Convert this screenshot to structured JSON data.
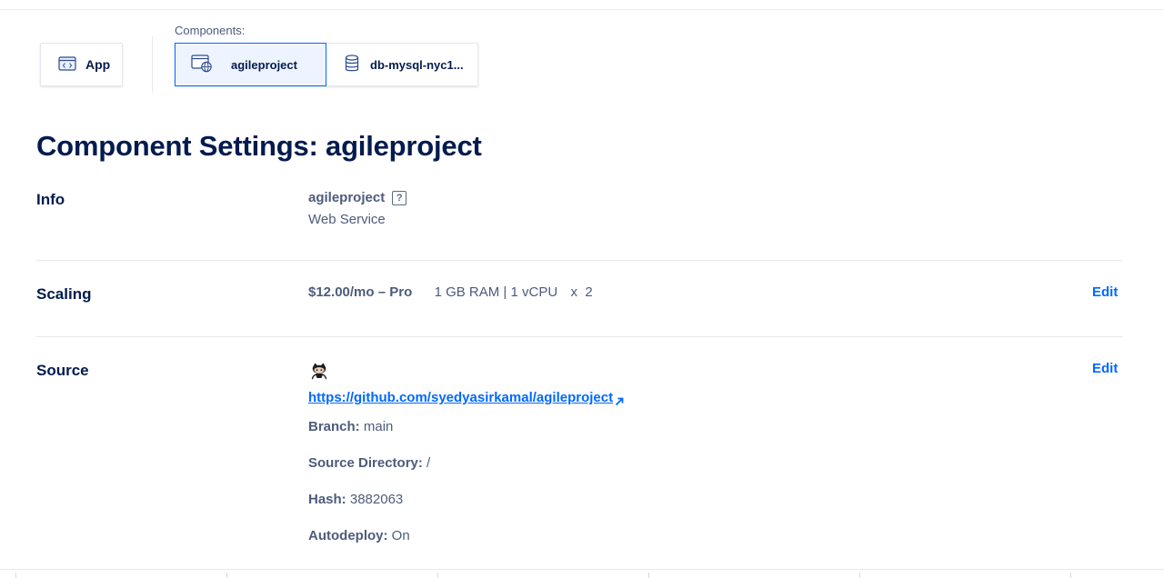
{
  "apps": {
    "app_label": "App"
  },
  "components": {
    "label": "Components:",
    "tabs": [
      {
        "label": "agileproject",
        "icon": "web-service-icon",
        "active": true
      },
      {
        "label": "db-mysql-nyc1...",
        "icon": "database-icon",
        "active": false
      }
    ]
  },
  "settings": {
    "title": "Component Settings: agileproject",
    "info": {
      "label": "Info",
      "name": "agileproject",
      "help": "?",
      "type": "Web Service"
    },
    "scaling": {
      "label": "Scaling",
      "price": "$12.00/mo – Pro",
      "specs": "1 GB RAM | 1 vCPU",
      "count": "x  2",
      "edit": "Edit"
    },
    "source": {
      "label": "Source",
      "provider_icon": "github-icon",
      "url": "https://github.com/syedyasirkamal/agileproject",
      "edit": "Edit",
      "branch_key": "Branch:",
      "branch_val": "main",
      "dir_key": "Source Directory:",
      "dir_val": "/",
      "hash_key": "Hash:",
      "hash_val": "3882063",
      "autodeploy_key": "Autodeploy:",
      "autodeploy_val": "On"
    }
  },
  "colors": {
    "accent": "#0069ff",
    "heading": "#031b4e",
    "body_text": "#4d5b7c"
  }
}
